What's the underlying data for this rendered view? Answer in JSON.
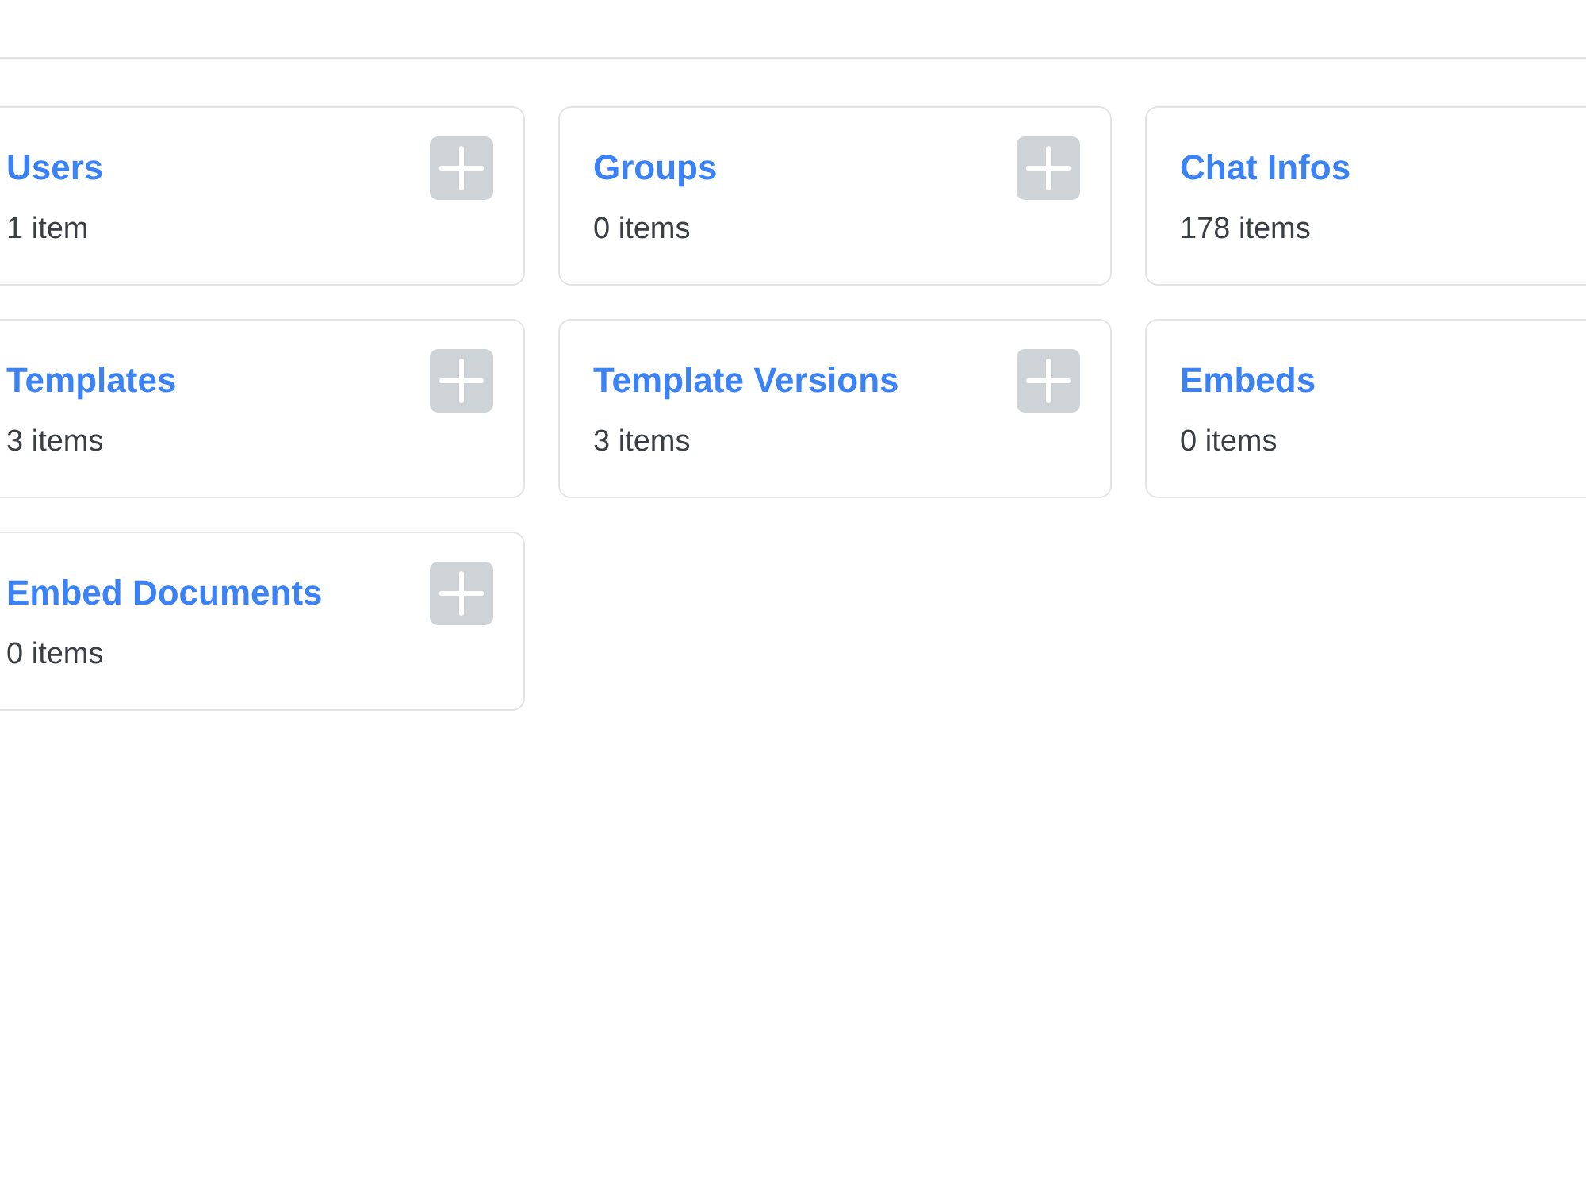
{
  "collections": [
    {
      "title": "Users",
      "count": "1 item",
      "add_button": true
    },
    {
      "title": "Groups",
      "count": "0 items",
      "add_button": true
    },
    {
      "title": "Chat Infos",
      "count": "178 items",
      "add_button": false
    },
    {
      "title": "Templates",
      "count": "3 items",
      "add_button": true
    },
    {
      "title": "Template Versions",
      "count": "3 items",
      "add_button": true
    },
    {
      "title": "Embeds",
      "count": "0 items",
      "add_button": false
    },
    {
      "title": "Embed Documents",
      "count": "0 items",
      "add_button": true
    }
  ]
}
